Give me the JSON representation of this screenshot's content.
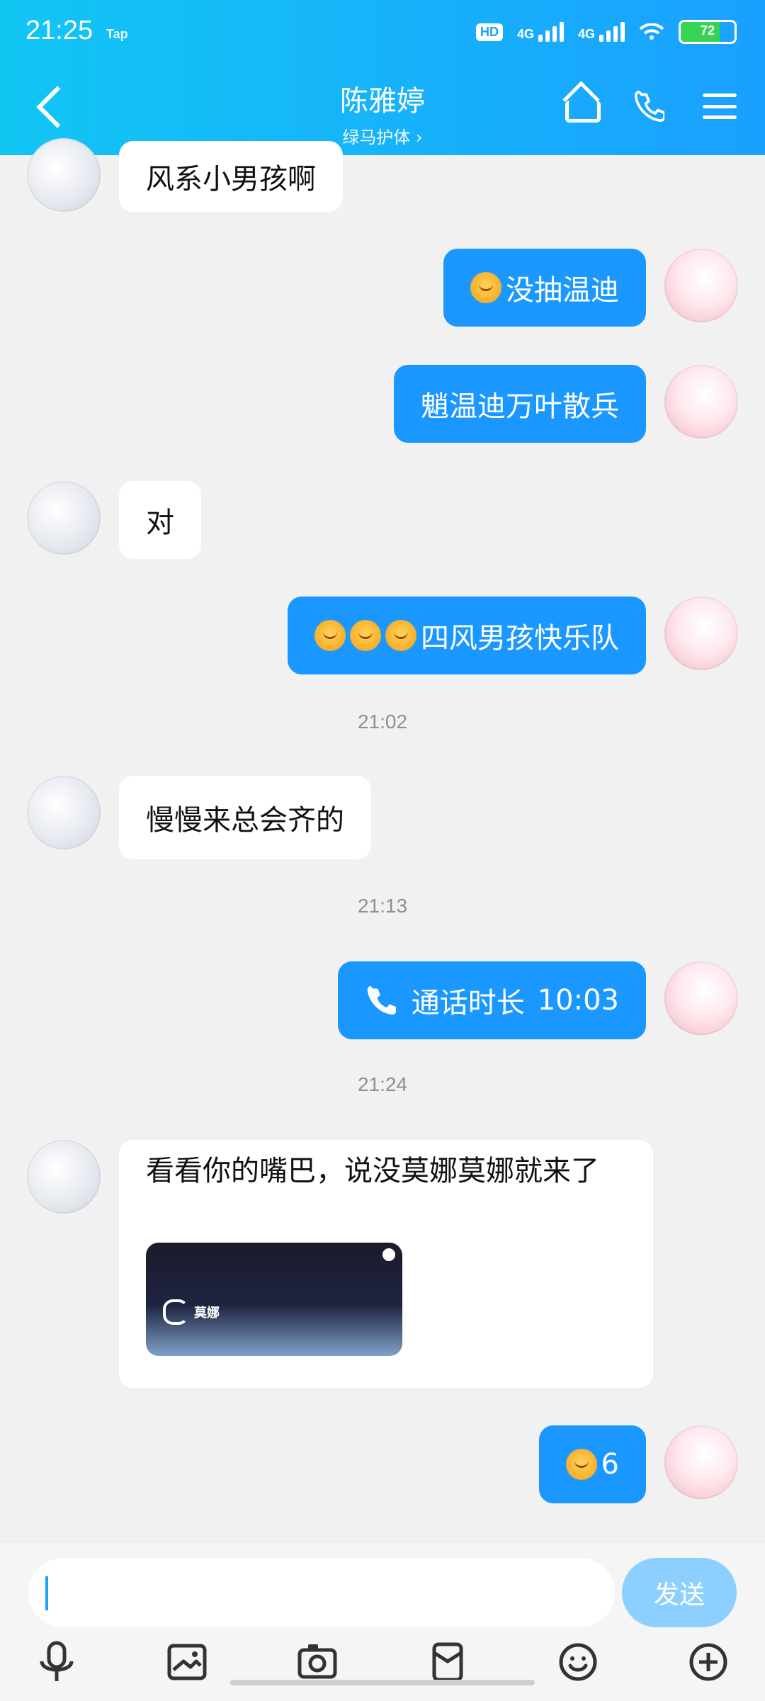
{
  "status_bar": {
    "time": "21:25",
    "tap": "Tap",
    "hd": "HD",
    "net1": "4G",
    "net2": "4G",
    "battery": "72"
  },
  "header": {
    "back_label": "",
    "name": "陈雅婷",
    "subtitle": "绿马护体 ›"
  },
  "messages": [
    {
      "side": "left",
      "text": "风系小男孩啊"
    },
    {
      "side": "right",
      "text": "没抽温迪"
    },
    {
      "side": "right",
      "text": "魈温迪万叶散兵"
    },
    {
      "side": "left",
      "text": "对"
    },
    {
      "side": "right",
      "text": "四风男孩快乐队"
    },
    {
      "time": "21:02"
    },
    {
      "side": "left",
      "text": "慢慢来总会齐的"
    },
    {
      "time": "21:13"
    },
    {
      "side": "right",
      "call_label": "通话时长",
      "call_duration": "10:03"
    },
    {
      "time": "21:24"
    },
    {
      "side": "left",
      "text": "看看你的嘴巴，说没莫娜莫娜就来了",
      "image_caption": "莫娜"
    },
    {
      "side": "right",
      "text": "6"
    }
  ],
  "input": {
    "placeholder": "",
    "send_label": "发送"
  }
}
